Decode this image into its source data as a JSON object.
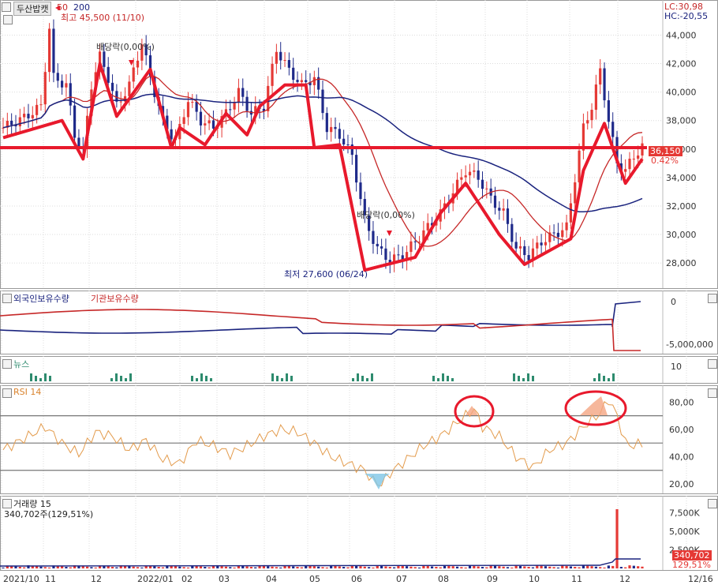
{
  "header": {
    "stock_name": "두산밥캣",
    "ma_periods": [
      "50",
      "200"
    ],
    "high_label": "최고 45,500 (11/10)",
    "low_label": "최저 27,600 (06/24)",
    "lc_label": "LC:30,98",
    "hc_label": "HC:-20,55",
    "dividend_label_1": "배당락(0,00%)",
    "dividend_label_2": "배당락(0,00%)"
  },
  "panes": {
    "holdings_title_foreign": "외국인보유수량",
    "holdings_title_inst": "기관보유수량",
    "news_title": "뉴스",
    "rsi_title": "RSI 14",
    "volume_title": "거래량  15",
    "volume_sub": "340,702주(129,51%)"
  },
  "colors": {
    "candle_up": "#e53935",
    "candle_down": "#1f2a8a",
    "ma50": "#c62828",
    "ma200": "#1a237e",
    "trendline": "#e8192c",
    "rsi_line": "#e39b4c",
    "news_bar": "#2e8b6e",
    "grid": "#dcdcdc"
  },
  "chart_data": [
    {
      "type": "candlestick",
      "title": "두산밥캣",
      "x_tick_labels": [
        "2021/10",
        "11",
        "12",
        "2022/01",
        "02",
        "03",
        "04",
        "05",
        "06",
        "07",
        "08",
        "09",
        "10",
        "11",
        "12",
        "12/16"
      ],
      "y_ticks": [
        "28,000",
        "30,000",
        "32,000",
        "34,000",
        "36,000",
        "38,000",
        "40,000",
        "42,000",
        "44,000"
      ],
      "ylim": [
        26400,
        45800
      ],
      "last_price": "36,150",
      "last_change": "0.42%",
      "horizontal_line": 36100,
      "approx_close_path": [
        [
          0,
          37500
        ],
        [
          5,
          38200
        ],
        [
          9,
          39000
        ],
        [
          11,
          44500
        ],
        [
          12,
          41000
        ],
        [
          15,
          40500
        ],
        [
          17,
          37000
        ],
        [
          19,
          35800
        ],
        [
          21,
          40500
        ],
        [
          23,
          42500
        ],
        [
          25,
          41000
        ],
        [
          27,
          39000
        ],
        [
          30,
          40500
        ],
        [
          33,
          43500
        ],
        [
          35,
          41000
        ],
        [
          38,
          38000
        ],
        [
          41,
          36500
        ],
        [
          44,
          39500
        ],
        [
          47,
          38000
        ],
        [
          50,
          37500
        ],
        [
          53,
          38500
        ],
        [
          56,
          40000
        ],
        [
          59,
          38500
        ],
        [
          62,
          39000
        ],
        [
          65,
          43000
        ],
        [
          68,
          41500
        ],
        [
          71,
          40500
        ],
        [
          74,
          41000
        ],
        [
          77,
          37500
        ],
        [
          80,
          37000
        ],
        [
          83,
          35500
        ],
        [
          86,
          31000
        ],
        [
          89,
          29000
        ],
        [
          92,
          28200
        ],
        [
          95,
          28500
        ],
        [
          98,
          29500
        ],
        [
          101,
          30500
        ],
        [
          104,
          31500
        ],
        [
          107,
          33000
        ],
        [
          110,
          34500
        ],
        [
          113,
          34000
        ],
        [
          116,
          32500
        ],
        [
          119,
          31500
        ],
        [
          122,
          29000
        ],
        [
          125,
          28500
        ],
        [
          128,
          29500
        ],
        [
          131,
          30000
        ],
        [
          134,
          30500
        ],
        [
          136,
          34000
        ],
        [
          138,
          37500
        ],
        [
          140,
          39000
        ],
        [
          142,
          41500
        ],
        [
          144,
          38000
        ],
        [
          146,
          35000
        ],
        [
          148,
          34500
        ],
        [
          150,
          35500
        ],
        [
          152,
          36150
        ]
      ],
      "series": [
        {
          "name": "50",
          "color": "#c62828"
        },
        {
          "name": "200",
          "color": "#1a237e"
        }
      ],
      "annotations": [
        "최고 45,500 (11/10)",
        "최저 27,600 (06/24)",
        "배당락(0,00%)",
        "배당락(0,00%)"
      ]
    },
    {
      "type": "line",
      "title": "외국인보유수량 / 기관보유수량",
      "y_ticks": [
        "0",
        "-5,000,000"
      ],
      "series": [
        {
          "name": "외국인보유수량",
          "color": "#1a237e"
        },
        {
          "name": "기관보유수량",
          "color": "#c62828"
        }
      ]
    },
    {
      "type": "bar",
      "title": "뉴스",
      "y_ticks": [
        "10"
      ]
    },
    {
      "type": "line",
      "title": "RSI 14",
      "y_ticks": [
        "20,00",
        "40,00",
        "60,00",
        "80,00"
      ],
      "ylim": [
        16,
        90
      ],
      "reference_lines": [
        30,
        50,
        70
      ],
      "approx_values": [
        [
          0,
          45
        ],
        [
          6,
          55
        ],
        [
          10,
          62
        ],
        [
          14,
          50
        ],
        [
          18,
          42
        ],
        [
          22,
          58
        ],
        [
          26,
          55
        ],
        [
          30,
          45
        ],
        [
          34,
          52
        ],
        [
          38,
          38
        ],
        [
          42,
          35
        ],
        [
          46,
          52
        ],
        [
          50,
          48
        ],
        [
          54,
          42
        ],
        [
          58,
          48
        ],
        [
          62,
          55
        ],
        [
          66,
          60
        ],
        [
          70,
          58
        ],
        [
          74,
          50
        ],
        [
          78,
          40
        ],
        [
          82,
          35
        ],
        [
          86,
          30
        ],
        [
          88,
          22
        ],
        [
          90,
          20
        ],
        [
          92,
          28
        ],
        [
          96,
          38
        ],
        [
          100,
          48
        ],
        [
          104,
          55
        ],
        [
          108,
          65
        ],
        [
          112,
          75
        ],
        [
          114,
          62
        ],
        [
          118,
          55
        ],
        [
          122,
          40
        ],
        [
          126,
          32
        ],
        [
          130,
          45
        ],
        [
          134,
          50
        ],
        [
          138,
          62
        ],
        [
          142,
          72
        ],
        [
          144,
          82
        ],
        [
          146,
          70
        ],
        [
          148,
          50
        ],
        [
          150,
          48
        ],
        [
          152,
          50
        ]
      ]
    },
    {
      "type": "bar",
      "title": "거래량 15",
      "y_ticks": [
        "2,500K",
        "5,000K",
        "7,500K"
      ],
      "last_value": "340,702",
      "last_pct": "129,51%",
      "peak_value_k": 8000
    }
  ]
}
